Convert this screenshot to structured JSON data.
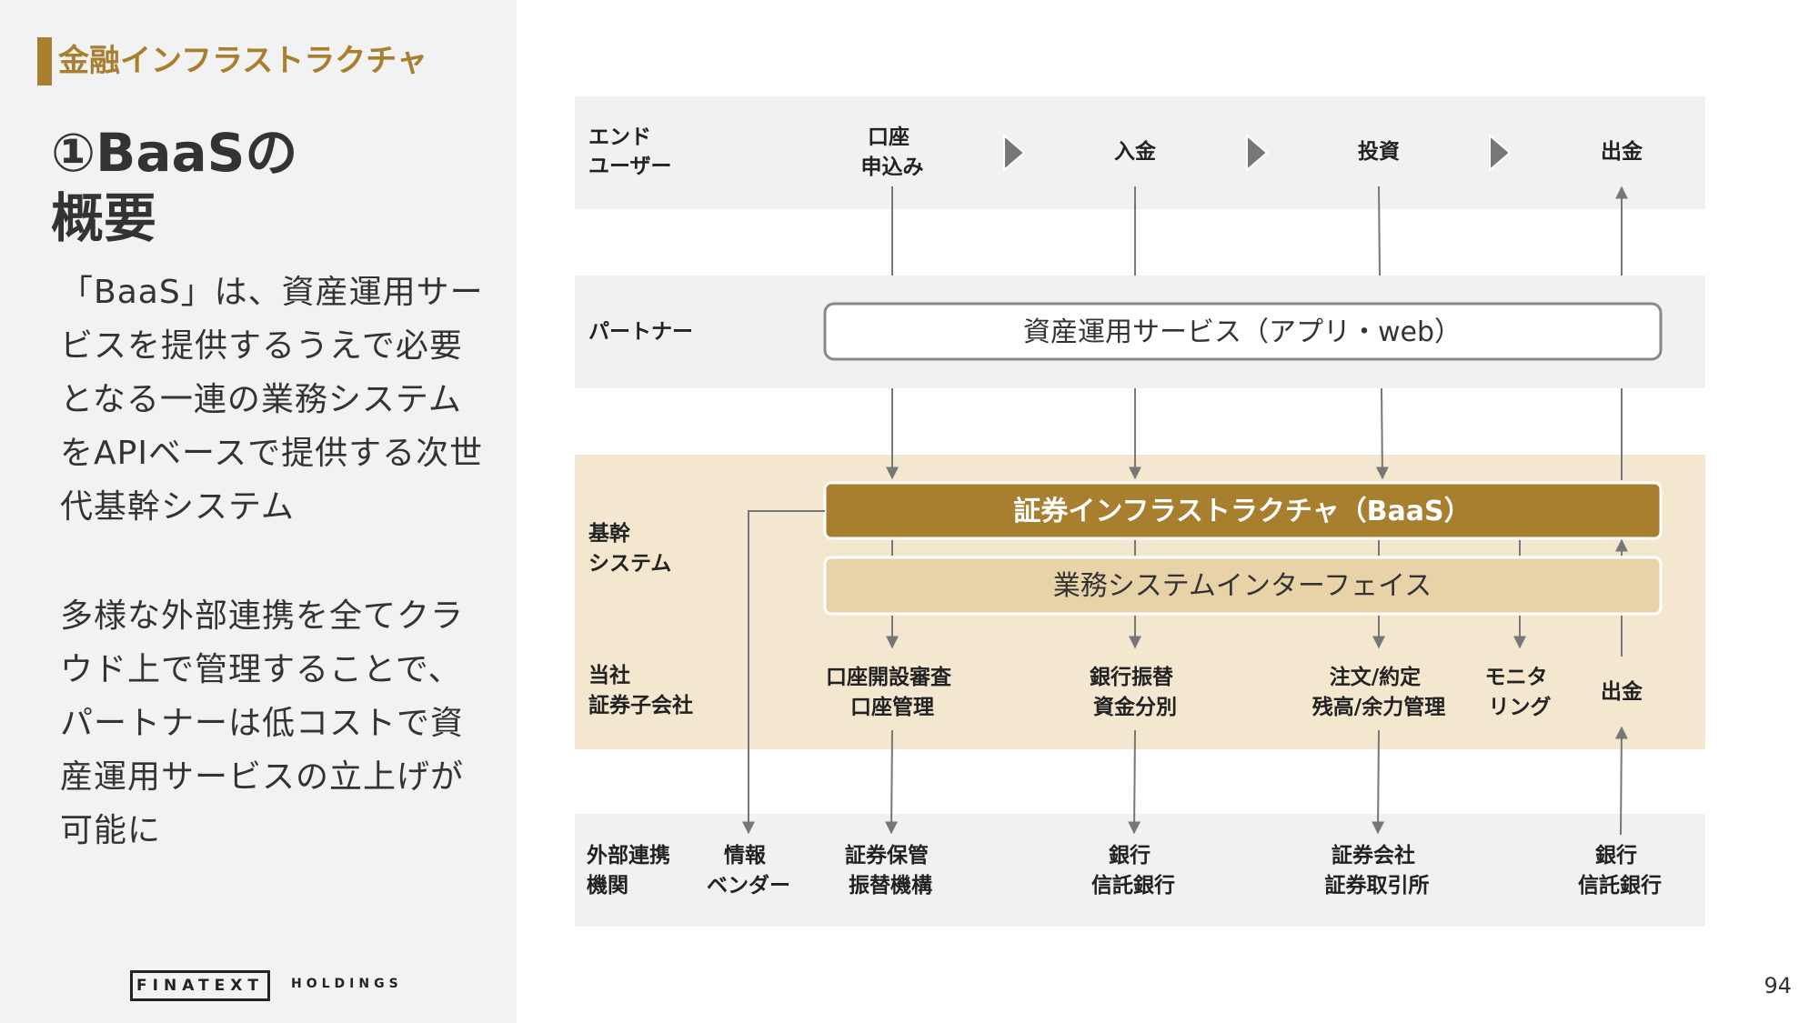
{
  "header": {
    "section": "金融インフラストラクチャ",
    "title": "①BaaSの\n概要"
  },
  "description": {
    "p1": "「BaaS」は、資産運用サービスを提供するうえで必要となる一連の業務システムをAPIベースで提供する次世代基幹システム",
    "p2": "多様な外部連携を全てクラウド上で管理することで、パートナーは低コストで資産運用サービスの立上げが可能に"
  },
  "footer": {
    "logo": "FINATEXT",
    "logo_sub": "HOLDINGS",
    "page": "94"
  },
  "colors": {
    "gold": "#a87e2f",
    "beige_band": "#f3e7d0",
    "beige_box": "#e8d3a8",
    "gray_band": "#f1f1f1"
  },
  "diagram": {
    "rows": {
      "end_user": [
        "エンド",
        "ユーザー"
      ],
      "partner": [
        "パートナー"
      ],
      "core": [
        "基幹",
        "システム"
      ],
      "company": [
        "当社",
        "証券子会社"
      ],
      "external": [
        "外部連携",
        "機関"
      ]
    },
    "end_user_steps": [
      {
        "lines": [
          "口座",
          "申込み"
        ]
      },
      {
        "lines": [
          "入金"
        ]
      },
      {
        "lines": [
          "投資"
        ]
      },
      {
        "lines": [
          "出金"
        ]
      }
    ],
    "partner_box": "資産運用サービス（アプリ・web）",
    "baas_box": "証券インフラストラクチャ（BaaS）",
    "interface_box": "業務システムインターフェイス",
    "company_items": [
      {
        "lines": [
          "口座開設審査",
          "口座管理"
        ]
      },
      {
        "lines": [
          "銀行振替",
          "資金分別"
        ]
      },
      {
        "lines": [
          "注文/約定",
          "残高/余力管理"
        ]
      },
      {
        "lines": [
          "モニタ",
          "リング"
        ]
      },
      {
        "lines": [
          "出金"
        ]
      }
    ],
    "external_items": [
      {
        "lines": [
          "情報",
          "ベンダー"
        ]
      },
      {
        "lines": [
          "証券保管",
          "振替機構"
        ]
      },
      {
        "lines": [
          "銀行",
          "信託銀行"
        ]
      },
      {
        "lines": [
          "証券会社",
          "証券取引所"
        ]
      },
      {
        "lines": [
          "銀行",
          "信託銀行"
        ]
      }
    ]
  }
}
